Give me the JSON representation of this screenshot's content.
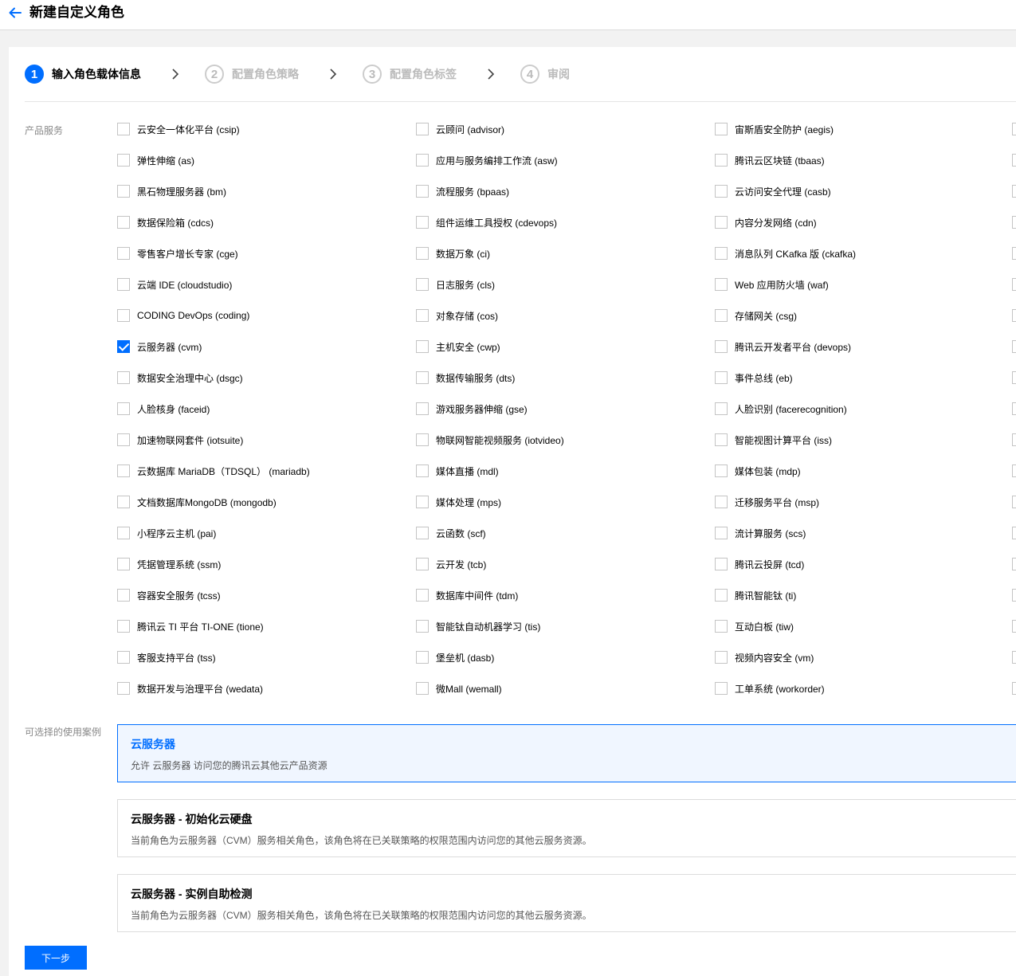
{
  "header": {
    "title": "新建自定义角色"
  },
  "steps": [
    {
      "num": "1",
      "label": "输入角色载体信息",
      "active": true
    },
    {
      "num": "2",
      "label": "配置角色策略",
      "active": false
    },
    {
      "num": "3",
      "label": "配置角色标签",
      "active": false
    },
    {
      "num": "4",
      "label": "审阅",
      "active": false
    }
  ],
  "services_label": "产品服务",
  "services": [
    {
      "label": "云安全一体化平台 (csip)",
      "checked": false
    },
    {
      "label": "云顾问 (advisor)",
      "checked": false
    },
    {
      "label": "宙斯盾安全防护 (aegis)",
      "checked": false
    },
    {
      "label": "弹性伸缩 (as)",
      "checked": false
    },
    {
      "label": "应用与服务编排工作流 (asw)",
      "checked": false
    },
    {
      "label": "腾讯云区块链 (tbaas)",
      "checked": false
    },
    {
      "label": "黑石物理服务器 (bm)",
      "checked": false
    },
    {
      "label": "流程服务 (bpaas)",
      "checked": false
    },
    {
      "label": "云访问安全代理 (casb)",
      "checked": false
    },
    {
      "label": "数据保险箱 (cdcs)",
      "checked": false
    },
    {
      "label": "组件运维工具授权 (cdevops)",
      "checked": false
    },
    {
      "label": "内容分发网络 (cdn)",
      "checked": false
    },
    {
      "label": "零售客户增长专家 (cge)",
      "checked": false
    },
    {
      "label": "数据万象 (ci)",
      "checked": false
    },
    {
      "label": "消息队列 CKafka 版 (ckafka)",
      "checked": false
    },
    {
      "label": "云端 IDE (cloudstudio)",
      "checked": false
    },
    {
      "label": "日志服务 (cls)",
      "checked": false
    },
    {
      "label": "Web 应用防火墙 (waf)",
      "checked": false
    },
    {
      "label": "CODING DevOps (coding)",
      "checked": false
    },
    {
      "label": "对象存储 (cos)",
      "checked": false
    },
    {
      "label": "存储网关 (csg)",
      "checked": false
    },
    {
      "label": "云服务器 (cvm)",
      "checked": true
    },
    {
      "label": "主机安全 (cwp)",
      "checked": false
    },
    {
      "label": "腾讯云开发者平台 (devops)",
      "checked": false
    },
    {
      "label": "数据安全治理中心 (dsgc)",
      "checked": false
    },
    {
      "label": "数据传输服务 (dts)",
      "checked": false
    },
    {
      "label": "事件总线 (eb)",
      "checked": false
    },
    {
      "label": "人脸核身 (faceid)",
      "checked": false
    },
    {
      "label": "游戏服务器伸缩 (gse)",
      "checked": false
    },
    {
      "label": "人脸识别 (facerecognition)",
      "checked": false
    },
    {
      "label": "加速物联网套件 (iotsuite)",
      "checked": false
    },
    {
      "label": "物联网智能视频服务 (iotvideo)",
      "checked": false
    },
    {
      "label": "智能视图计算平台 (iss)",
      "checked": false
    },
    {
      "label": "云数据库 MariaDB（TDSQL） (mariadb)",
      "checked": false
    },
    {
      "label": "媒体直播 (mdl)",
      "checked": false
    },
    {
      "label": "媒体包装 (mdp)",
      "checked": false
    },
    {
      "label": "文档数据库MongoDB (mongodb)",
      "checked": false
    },
    {
      "label": "媒体处理 (mps)",
      "checked": false
    },
    {
      "label": "迁移服务平台 (msp)",
      "checked": false
    },
    {
      "label": "小程序云主机 (pai)",
      "checked": false
    },
    {
      "label": "云函数 (scf)",
      "checked": false
    },
    {
      "label": "流计算服务 (scs)",
      "checked": false
    },
    {
      "label": "凭据管理系统 (ssm)",
      "checked": false
    },
    {
      "label": "云开发 (tcb)",
      "checked": false
    },
    {
      "label": "腾讯云投屏 (tcd)",
      "checked": false
    },
    {
      "label": "容器安全服务 (tcss)",
      "checked": false
    },
    {
      "label": "数据库中间件 (tdm)",
      "checked": false
    },
    {
      "label": "腾讯智能钛 (ti)",
      "checked": false
    },
    {
      "label": "腾讯云 TI 平台 TI-ONE (tione)",
      "checked": false
    },
    {
      "label": "智能钛自动机器学习 (tis)",
      "checked": false
    },
    {
      "label": "互动白板 (tiw)",
      "checked": false
    },
    {
      "label": "客服支持平台 (tss)",
      "checked": false
    },
    {
      "label": "堡垒机 (dasb)",
      "checked": false
    },
    {
      "label": "视频内容安全 (vm)",
      "checked": false
    },
    {
      "label": "数据开发与治理平台 (wedata)",
      "checked": false
    },
    {
      "label": "微Mall (wemall)",
      "checked": false
    },
    {
      "label": "工单系统 (workorder)",
      "checked": false
    }
  ],
  "use_cases_label": "可选择的使用案例",
  "use_cases": [
    {
      "title": "云服务器",
      "desc": "允许 云服务器 访问您的腾讯云其他云产品资源",
      "selected": true
    },
    {
      "title": "云服务器 - 初始化云硬盘",
      "desc": "当前角色为云服务器（CVM）服务相关角色，该角色将在已关联策略的权限范围内访问您的其他云服务资源。",
      "selected": false
    },
    {
      "title": "云服务器 - 实例自助检测",
      "desc": "当前角色为云服务器（CVM）服务相关角色，该角色将在已关联策略的权限范围内访问您的其他云服务资源。",
      "selected": false
    }
  ],
  "footer": {
    "next_label": "下一步"
  },
  "colors": {
    "primary": "#006eff",
    "selected_bg": "#f0f6ff"
  }
}
